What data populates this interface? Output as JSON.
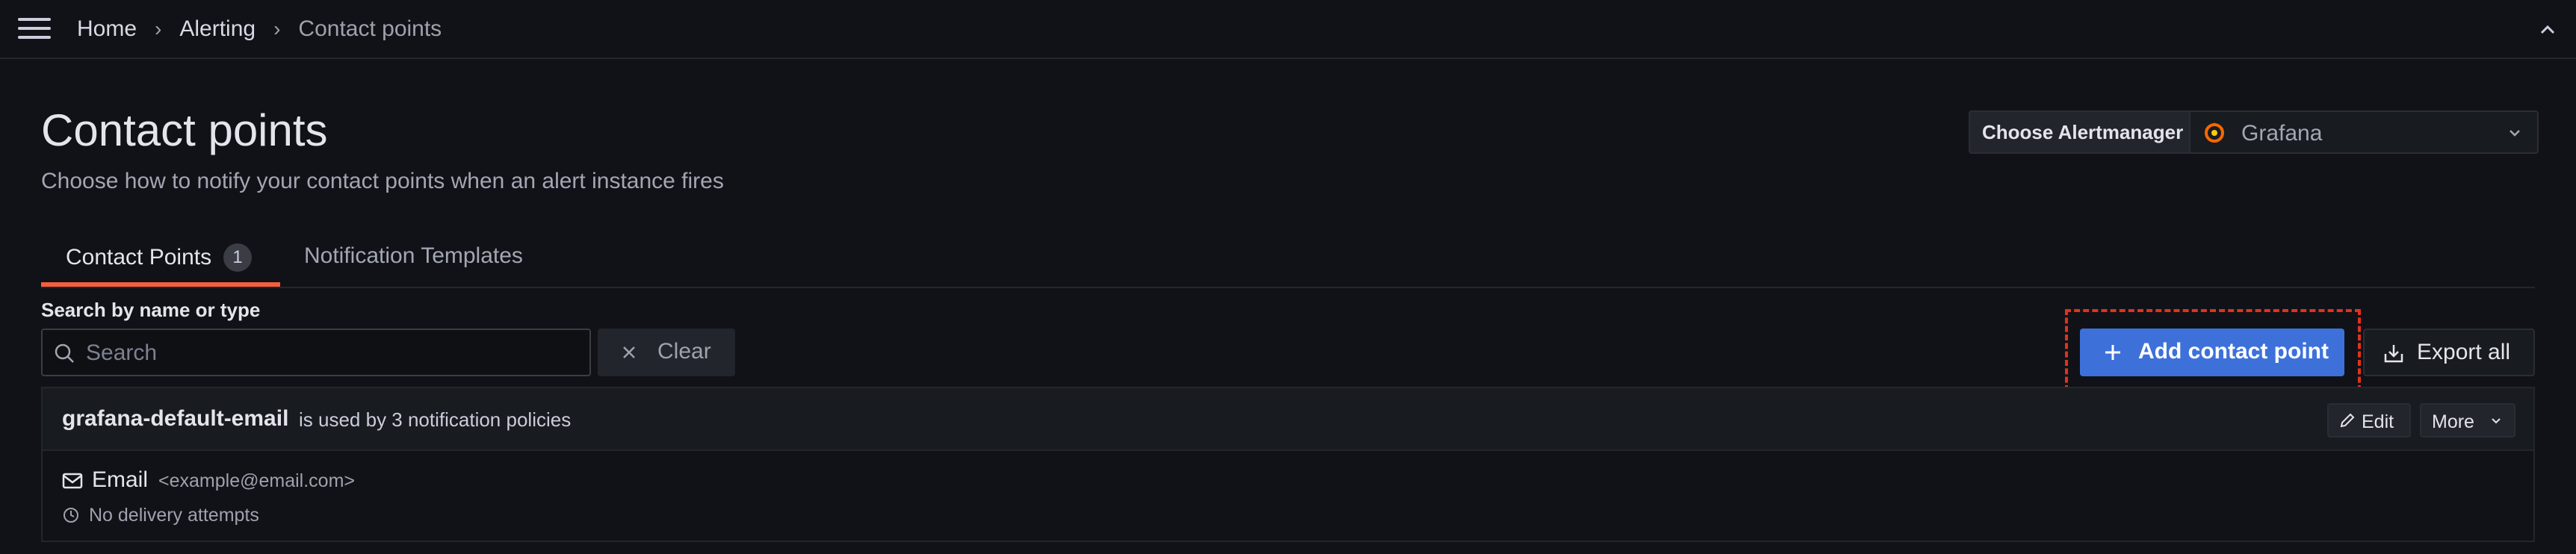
{
  "breadcrumbs": [
    "Home",
    "Alerting",
    "Contact points"
  ],
  "page": {
    "title": "Contact points",
    "subtitle": "Choose how to notify your contact points when an alert instance fires"
  },
  "alertmanager": {
    "label": "Choose Alertmanager",
    "selected": "Grafana"
  },
  "tabs": [
    {
      "label": "Contact Points",
      "count": "1",
      "active": true
    },
    {
      "label": "Notification Templates",
      "active": false
    }
  ],
  "search": {
    "label": "Search by name or type",
    "placeholder": "Search",
    "clear_label": "Clear"
  },
  "actions": {
    "add_label": "Add contact point",
    "export_label": "Export all"
  },
  "contact_point": {
    "name": "grafana-default-email",
    "usage": "is used by 3 notification policies",
    "edit_label": "Edit",
    "more_label": "More",
    "integration": {
      "type": "Email",
      "address": "<example@email.com>",
      "delivery_status": "No delivery attempts"
    }
  },
  "colors": {
    "background": "#111217",
    "primary_button": "#3d71d9",
    "active_tab_underline": "#f55f3e",
    "highlight_border": "#e0321b"
  },
  "icons": [
    "menu-icon",
    "collapse-icon",
    "grafana-logo-icon",
    "chevron-down-icon",
    "search-icon",
    "close-icon",
    "plus-icon",
    "export-icon",
    "pencil-icon",
    "envelope-icon",
    "clock-icon"
  ]
}
